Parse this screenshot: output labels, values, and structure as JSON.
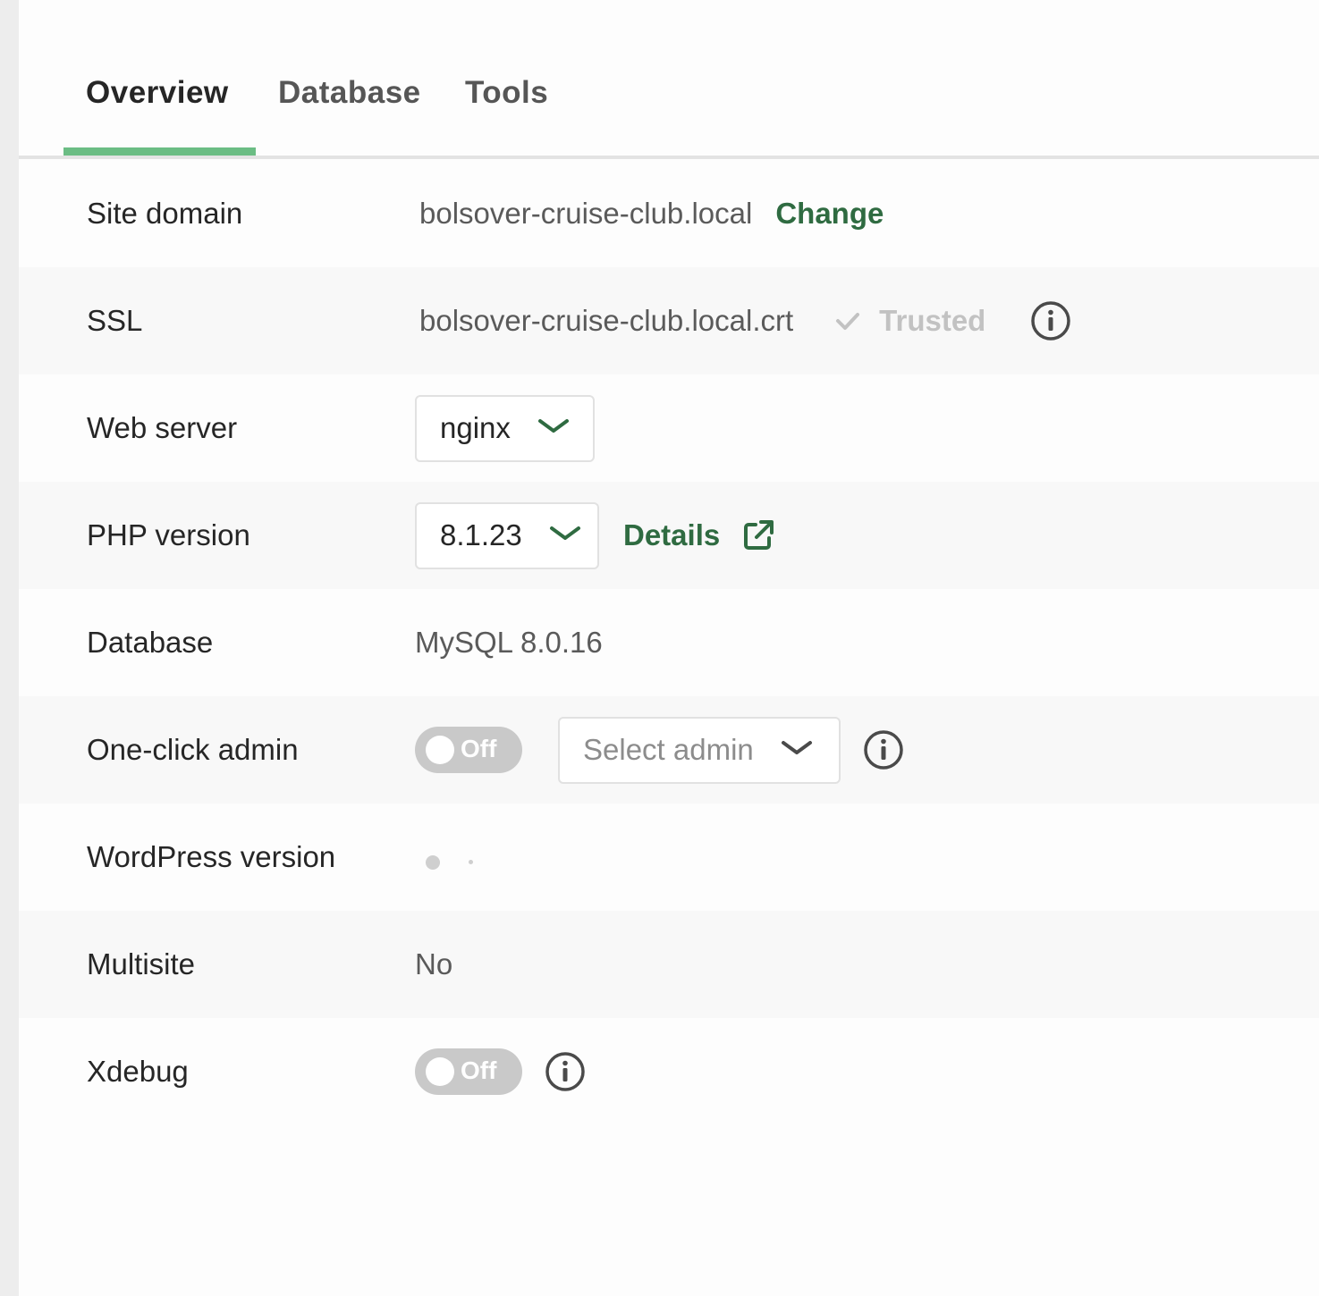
{
  "tabs": [
    {
      "label": "Overview",
      "active": true
    },
    {
      "label": "Database",
      "active": false
    },
    {
      "label": "Tools",
      "active": false
    }
  ],
  "rows": {
    "site_domain": {
      "label": "Site domain",
      "value": "bolsover-cruise-club.local",
      "action": "Change"
    },
    "ssl": {
      "label": "SSL",
      "value": "bolsover-cruise-club.local.crt",
      "status": "Trusted"
    },
    "web_server": {
      "label": "Web server",
      "value": "nginx"
    },
    "php_version": {
      "label": "PHP version",
      "value": "8.1.23",
      "link": "Details"
    },
    "database": {
      "label": "Database",
      "value": "MySQL 8.0.16"
    },
    "one_click_admin": {
      "label": "One-click admin",
      "toggle": "Off",
      "select_placeholder": "Select admin"
    },
    "wordpress_version": {
      "label": "WordPress version"
    },
    "multisite": {
      "label": "Multisite",
      "value": "No"
    },
    "xdebug": {
      "label": "Xdebug",
      "toggle": "Off"
    }
  },
  "colors": {
    "accent": "#6bbd84",
    "link": "#2f6b41",
    "toggle_off": "#c9c9c9"
  }
}
